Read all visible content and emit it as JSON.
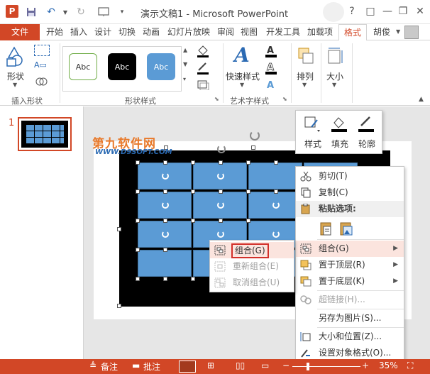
{
  "titlebar": {
    "title": "演示文稿1 - Microsoft PowerPoint",
    "buttons": [
      "?",
      "□",
      "—",
      "❐",
      "✕"
    ]
  },
  "tabs": [
    "文件",
    "开始",
    "插入",
    "设计",
    "切换",
    "动画",
    "幻灯片放映",
    "审阅",
    "视图",
    "开发工具",
    "加载项",
    "格式"
  ],
  "user": "胡俊",
  "ribbon": {
    "group_insert_shapes": {
      "label": "插入形状",
      "shapes_label": "形状"
    },
    "group_shape_styles": {
      "label": "形状样式",
      "style_samples": [
        "Abc",
        "Abc",
        "Abc"
      ]
    },
    "group_wordart": {
      "label": "艺术字样式",
      "quick_styles_label": "快速样式"
    },
    "arrange_label": "排列",
    "size_label": "大小"
  },
  "thumbnails": {
    "slide_number": "1"
  },
  "watermark": {
    "title": "第九软件网",
    "url": "WWW.D9SOFT.COM"
  },
  "mini_toolbar": {
    "items": [
      "样式",
      "填充",
      "轮廓"
    ]
  },
  "context_menu": {
    "items": [
      {
        "label": "剪切(T)",
        "icon": "scissors-icon",
        "disabled": false,
        "submenu": false
      },
      {
        "label": "复制(C)",
        "icon": "copy-icon",
        "disabled": false,
        "submenu": false
      },
      {
        "label": "粘贴选项:",
        "icon": "paste-icon",
        "disabled": false,
        "submenu": false
      },
      {
        "label": "组合(G)",
        "icon": "group-icon",
        "disabled": false,
        "submenu": true
      },
      {
        "label": "置于顶层(R)",
        "icon": "bring-front-icon",
        "disabled": false,
        "submenu": true
      },
      {
        "label": "置于底层(K)",
        "icon": "send-back-icon",
        "disabled": false,
        "submenu": true
      },
      {
        "label": "超链接(H)...",
        "icon": "hyperlink-icon",
        "disabled": true,
        "submenu": false
      },
      {
        "label": "另存为图片(S)...",
        "icon": "",
        "disabled": false,
        "submenu": false
      },
      {
        "label": "大小和位置(Z)...",
        "icon": "size-position-icon",
        "disabled": false,
        "submenu": false
      },
      {
        "label": "设置对象格式(O)...",
        "icon": "format-object-icon",
        "disabled": false,
        "submenu": false
      }
    ]
  },
  "group_submenu": {
    "items": [
      {
        "label": "组合(G)",
        "disabled": false
      },
      {
        "label": "重新组合(E)",
        "disabled": true
      },
      {
        "label": "取消组合(U)",
        "disabled": true
      }
    ]
  },
  "statusbar": {
    "notes": "备注",
    "comments": "批注",
    "zoom": "35%"
  },
  "colors": {
    "accent": "#d24726",
    "shape_fill": "#5b9bd5",
    "hover": "#fbe4de"
  }
}
